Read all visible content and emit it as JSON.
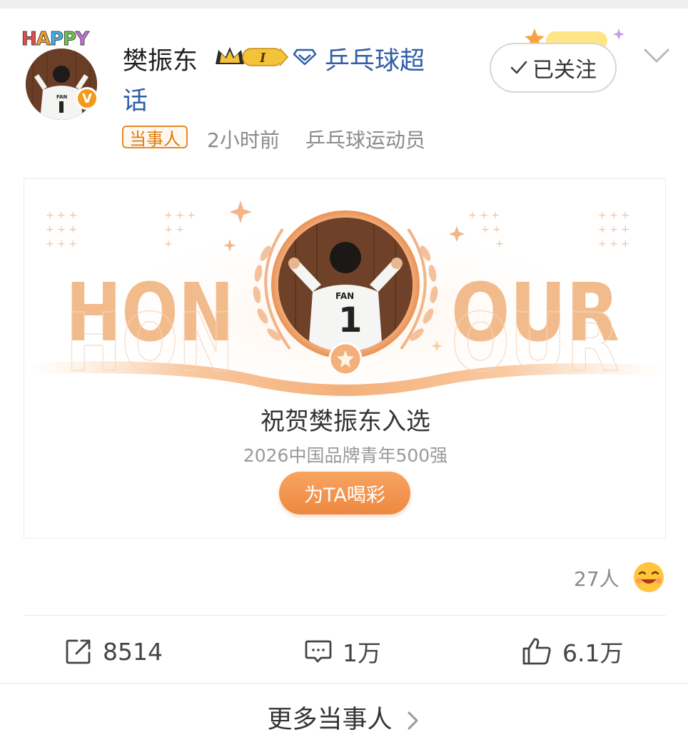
{
  "post": {
    "author": {
      "name": "樊振东",
      "avatar_badge": "HAPPY",
      "verified_label": "V",
      "jersey_text": "FAN",
      "jersey_number": "1",
      "level_badge": "I"
    },
    "topic_line1": "乒乓球超",
    "topic_line2": "话",
    "follow_button": {
      "label": "已关注"
    },
    "tag": "当事人",
    "time": "2小时前",
    "role": "乒乓球运动员"
  },
  "honour_card": {
    "banner_left": "HON",
    "banner_right": "OUR",
    "title": "祝贺樊振东入选",
    "subtitle": "2026中国品牌青年500强",
    "cheer_button": "为TA喝彩"
  },
  "reactions": {
    "count_label": "27人"
  },
  "actions": {
    "share_count": "8514",
    "comment_count": "1万",
    "like_count": "6.1万"
  },
  "more_link": "更多当事人",
  "colors": {
    "topic_blue": "#2f5ea8",
    "accent_orange": "#ee8840",
    "honour_peach": "#f2bb8c"
  }
}
